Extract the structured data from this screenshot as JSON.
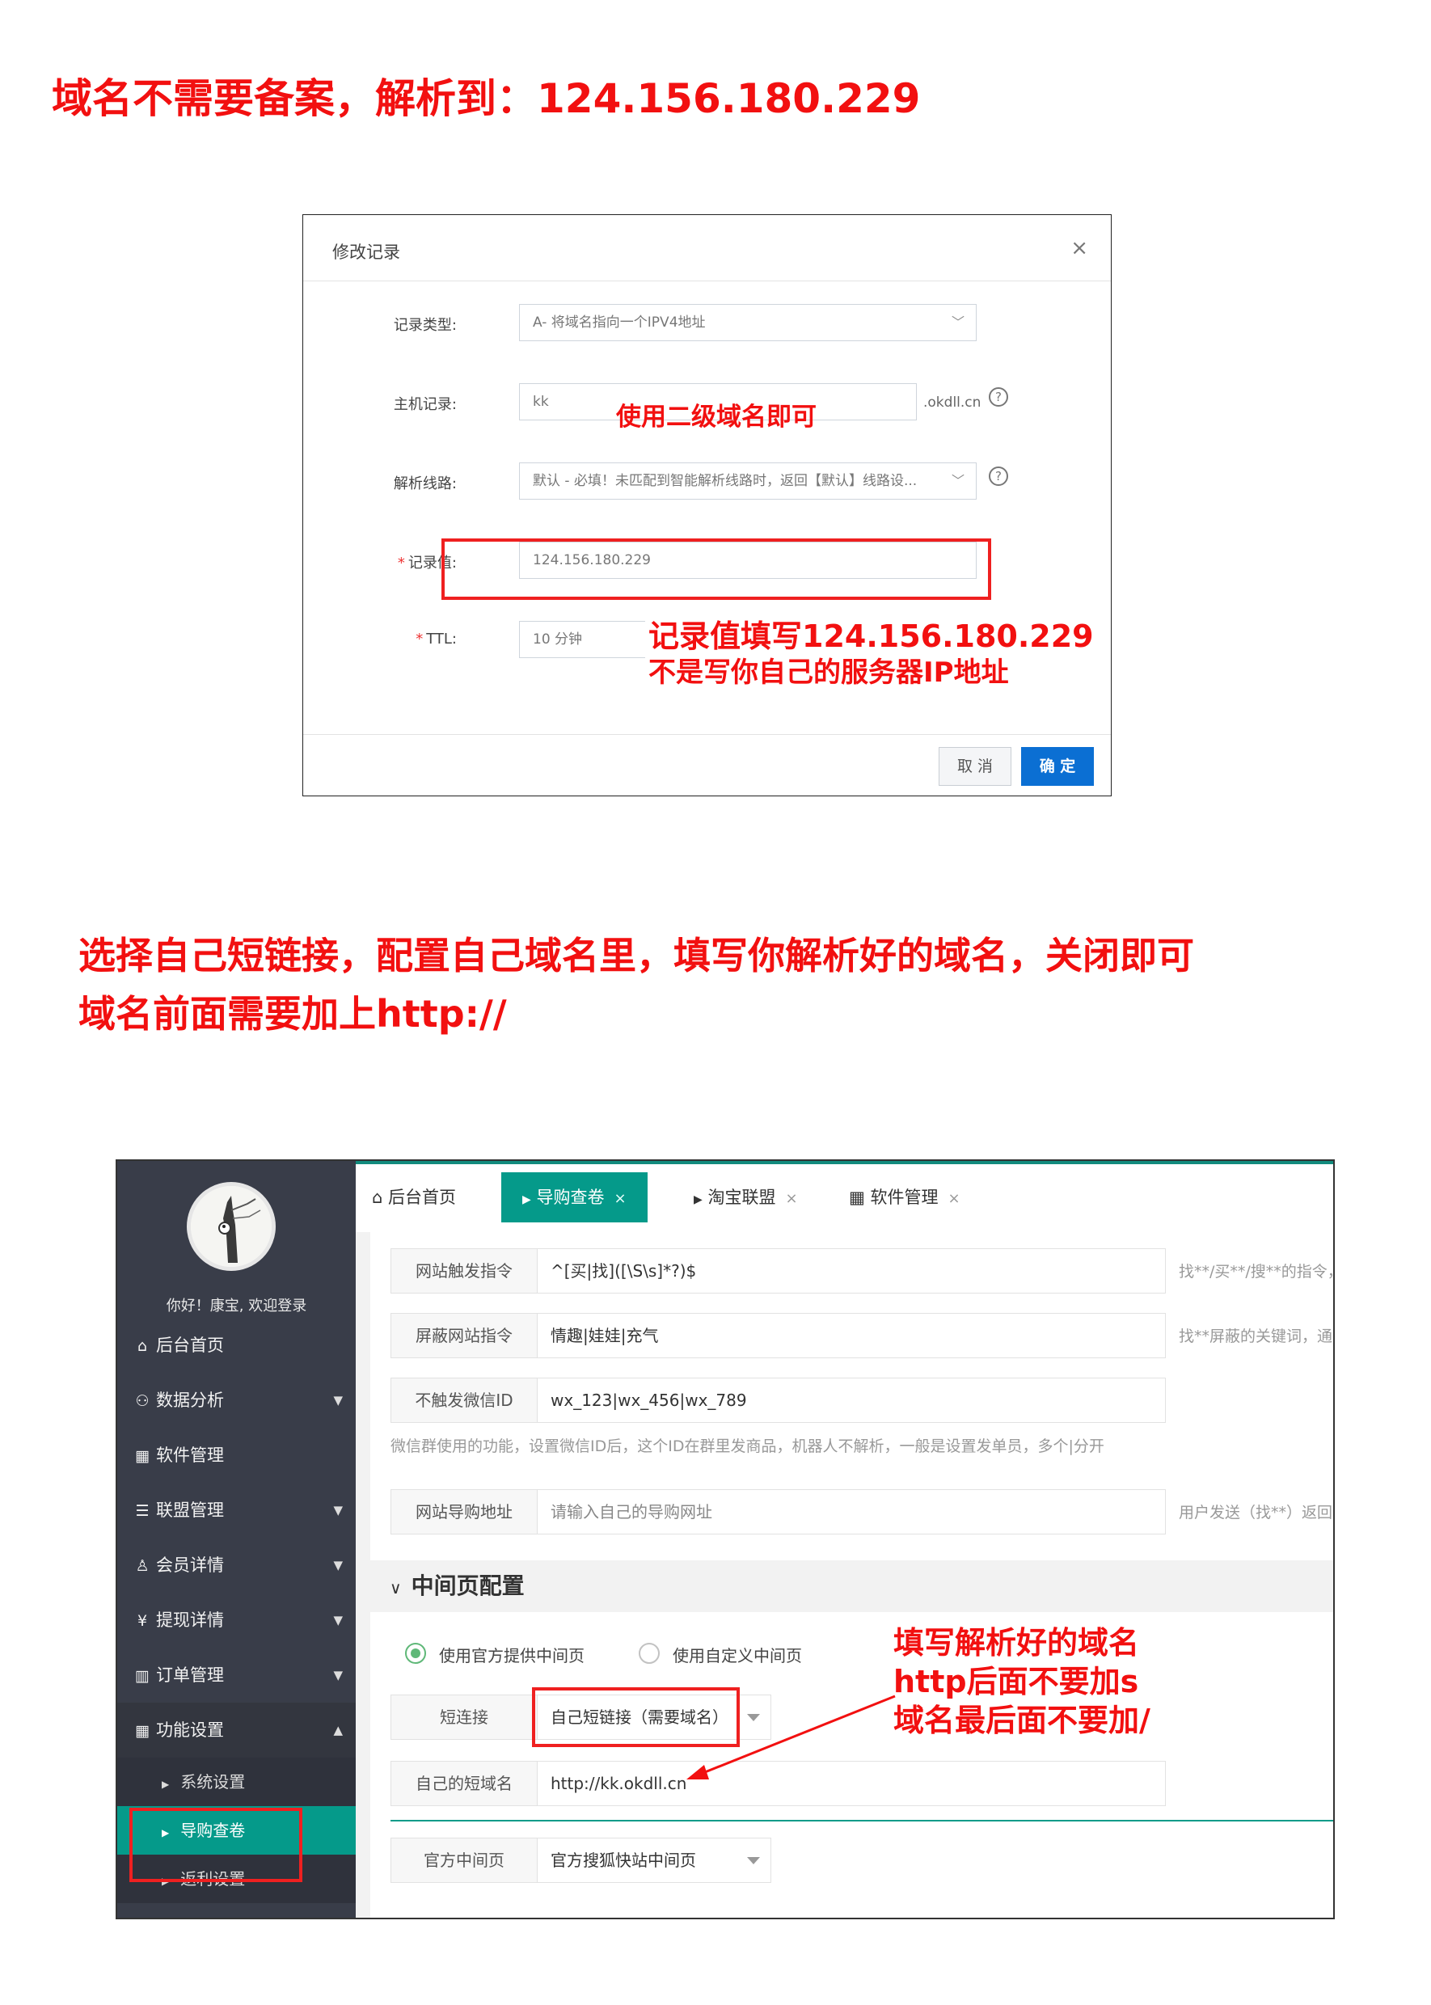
{
  "heading1": "域名不需要备案，解析到：124.156.180.229",
  "dialog": {
    "title": "修改记录",
    "close": "×",
    "fields": {
      "record_type": {
        "label": "记录类型:",
        "value": "A- 将域名指向一个IPV4地址",
        "caret": "﹀"
      },
      "host": {
        "label": "主机记录:",
        "value": "kk",
        "suffix": ".okdll.cn",
        "help": "?"
      },
      "line": {
        "label": "解析线路:",
        "value": "默认 - 必填！未匹配到智能解析线路时，返回【默认】线路设...",
        "caret": "﹀",
        "help": "?"
      },
      "record_value": {
        "label": "记录值:",
        "required": "*",
        "value": "124.156.180.229"
      },
      "ttl": {
        "label": "TTL:",
        "required": "*",
        "value": "10 分钟"
      }
    },
    "cancel": "取 消",
    "ok": "确 定"
  },
  "annotations": {
    "host_note": "使用二级域名即可",
    "record_note_1": "记录值填写124.156.180.229",
    "record_note_2": "不是写你自己的服务器IP地址",
    "instr_1": "选择自己短链接，配置自己域名里，填写你解析好的域名，关闭即可",
    "instr_2": "域名前面需要加上http://",
    "domain_note_1": "填写解析好的域名",
    "domain_note_2": "http后面不要加s",
    "domain_note_3": "域名最后面不要加/"
  },
  "admin": {
    "welcome": "你好！康宝, 欢迎登录",
    "nav": [
      {
        "icon": "⌂",
        "label": "后台首页",
        "arrow": ""
      },
      {
        "icon": "⚇",
        "label": "数据分析",
        "arrow": "▼"
      },
      {
        "icon": "▦",
        "label": "软件管理",
        "arrow": ""
      },
      {
        "icon": "☰",
        "label": "联盟管理",
        "arrow": "▼"
      },
      {
        "icon": "♙",
        "label": "会员详情",
        "arrow": "▼"
      },
      {
        "icon": "¥",
        "label": "提现详情",
        "arrow": "▼"
      },
      {
        "icon": "▥",
        "label": "订单管理",
        "arrow": "▼"
      },
      {
        "icon": "▦",
        "label": "功能设置",
        "arrow": "▲"
      }
    ],
    "subnav": [
      {
        "label": "系统设置"
      },
      {
        "label": "导购查卷"
      },
      {
        "label": "返利设置"
      }
    ],
    "tabs": [
      {
        "icon": "⌂",
        "label": "后台首页",
        "x": ""
      },
      {
        "icon": "▶",
        "label": "导购查卷",
        "x": "×"
      },
      {
        "icon": "▶",
        "label": "淘宝联盟",
        "x": "×"
      },
      {
        "icon": "▦",
        "label": "软件管理",
        "x": "×"
      }
    ],
    "form": {
      "trigger": {
        "label": "网站触发指令",
        "value": "^[买|找]([\\S\\s]*?)$",
        "tip": "找**/买**/搜**的指令，"
      },
      "block": {
        "label": "屏蔽网站指令",
        "value": "情趣|娃娃|充气",
        "tip": "找**屏蔽的关键词，通"
      },
      "no_trigger": {
        "label": "不触发微信ID",
        "value": "wx_123|wx_456|wx_789"
      },
      "no_trigger_desc": "微信群使用的功能，设置微信ID后，这个ID在群里发商品，机器人不解析，一般是设置发单员，多个|分开",
      "guide_url": {
        "label": "网站导购地址",
        "placeholder": "请输入自己的导购网址",
        "tip": "用户发送（找**）返回"
      }
    },
    "section_title": "中间页配置",
    "section_chevron": "∨",
    "radios": {
      "official": "使用官方提供中间页",
      "custom": "使用自定义中间页"
    },
    "short_link": {
      "label": "短连接",
      "value": "自己短链接（需要域名）"
    },
    "own_domain": {
      "label": "自己的短域名",
      "value": "http://kk.okdll.cn"
    },
    "official_page": {
      "label": "官方中间页",
      "value": "官方搜狐快站中间页"
    }
  },
  "colors": {
    "annotation_red": "#f21010",
    "sidebar": "#393d49",
    "teal": "#059a8a",
    "primary_blue": "#0b6fd3"
  }
}
